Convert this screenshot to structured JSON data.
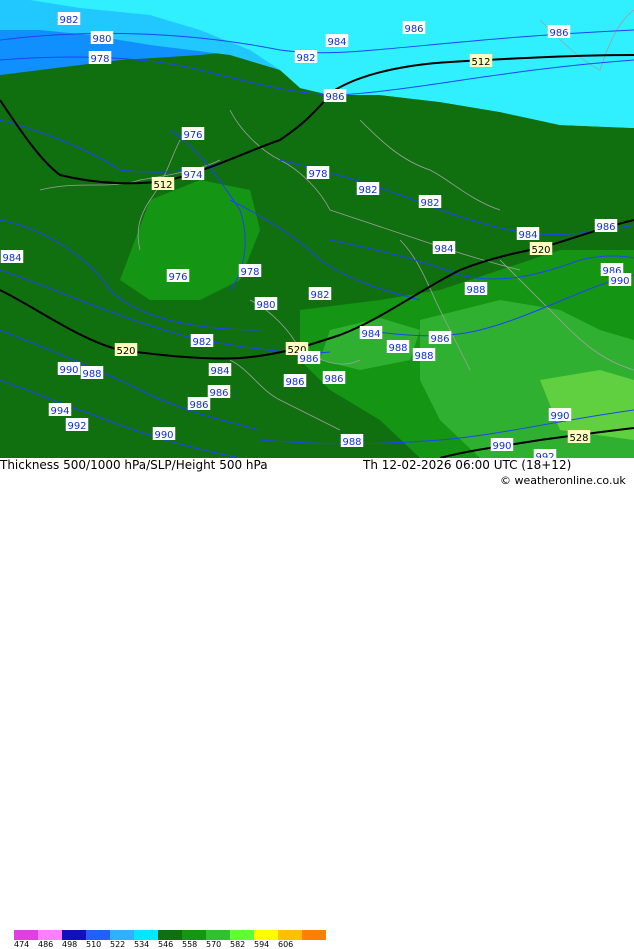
{
  "title": "Thickness 500/1000 hPa/SLP/Height 500 hPa",
  "datetime": "Th 12-02-2026 06:00 UTC (18+12)",
  "copyright": "© weatheronline.co.uk",
  "legend": {
    "ticks": [
      "474",
      "486",
      "498",
      "510",
      "522",
      "534",
      "546",
      "558",
      "570",
      "582",
      "594",
      "606"
    ],
    "colors": [
      "#e040e0",
      "#ff80ff",
      "#1010c0",
      "#2060ff",
      "#30b0ff",
      "#00e8ff",
      "#107010",
      "#149614",
      "#30c030",
      "#60ff30",
      "#ffff00",
      "#ffc000",
      "#ff8000"
    ]
  },
  "colors": {
    "dark_green": "#107010",
    "mid_green": "#149614",
    "light_green": "#30b030",
    "cyan": "#30f0ff",
    "sky": "#20c8ff",
    "blue": "#1090ff"
  },
  "slp_labels": [
    "982",
    "986",
    "986",
    "984",
    "980",
    "982",
    "978",
    "512",
    "986",
    "976",
    "974",
    "512",
    "978",
    "982",
    "982",
    "984",
    "986",
    "984",
    "520",
    "986",
    "984",
    "976",
    "978",
    "980",
    "982",
    "988",
    "990",
    "982",
    "520",
    "520",
    "984",
    "986",
    "990",
    "988",
    "984",
    "986",
    "988",
    "988",
    "986",
    "986",
    "986",
    "986",
    "994",
    "992",
    "990",
    "988",
    "990",
    "990",
    "528",
    "992"
  ],
  "isobar_values": [
    "512",
    "520",
    "528"
  ]
}
